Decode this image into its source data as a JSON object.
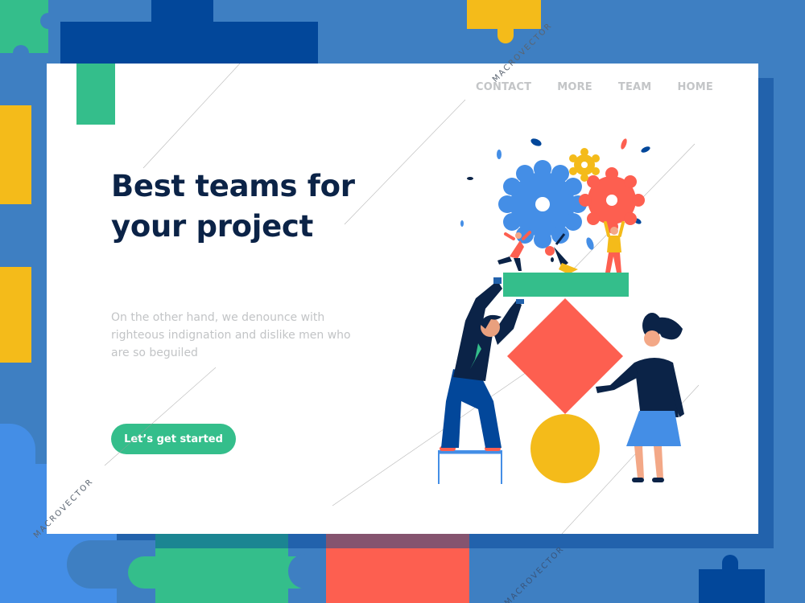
{
  "nav": {
    "items": [
      {
        "label": "CONTACT"
      },
      {
        "label": "MORE"
      },
      {
        "label": "TEAM"
      },
      {
        "label": "HOME"
      }
    ]
  },
  "hero": {
    "headline": "Best teams for your project",
    "body": "On the other hand, we denounce with righteous indignation and dislike men who are so beguiled",
    "cta_label": "Let’s get started"
  },
  "watermark": "MACROVECTOR",
  "colors": {
    "background_blue": "#3e7fc2",
    "dark_blue": "#02479a",
    "mid_blue": "#2262ac",
    "light_blue": "#448ee6",
    "green": "#34be8b",
    "yellow": "#f4bb1a",
    "coral": "#fd5f50",
    "navy_text": "#0b2347",
    "nav_gray": "#c3c5c7",
    "body_gray": "#c2c4c6"
  }
}
